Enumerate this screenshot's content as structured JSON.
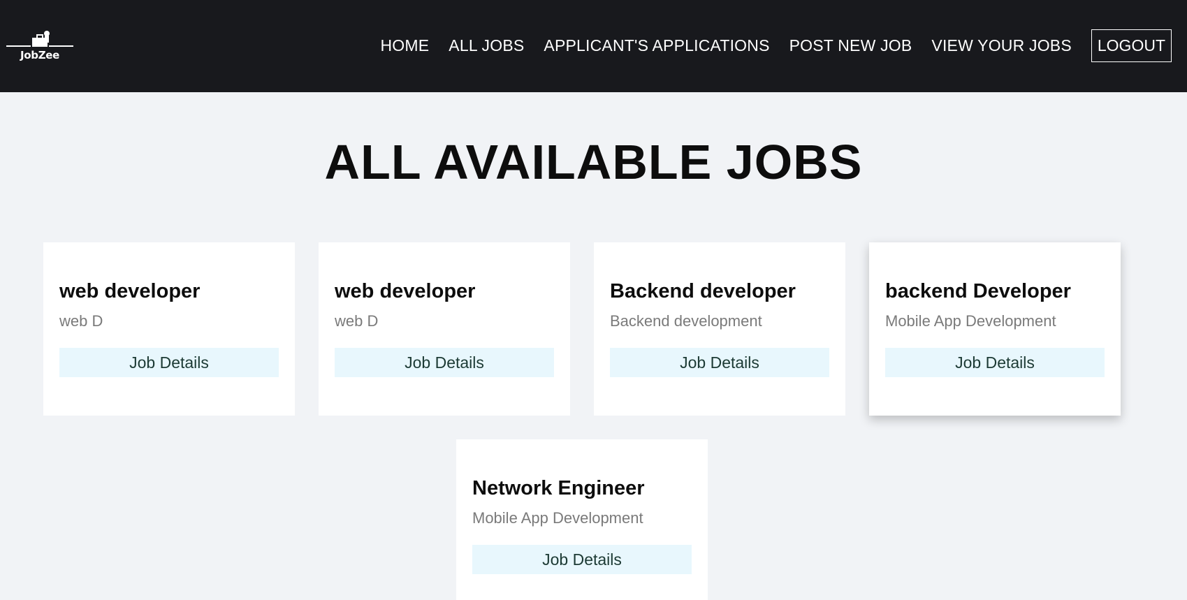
{
  "brand": {
    "name": "JobZee",
    "logo_icon": "job-seeker-logo-icon"
  },
  "nav": {
    "items": [
      {
        "label": "HOME"
      },
      {
        "label": "ALL JOBS"
      },
      {
        "label": "APPLICANT'S APPLICATIONS"
      },
      {
        "label": "POST NEW JOB"
      },
      {
        "label": "VIEW YOUR JOBS"
      }
    ],
    "logout_label": "LOGOUT"
  },
  "page": {
    "title": "ALL AVAILABLE JOBS"
  },
  "jobs": [
    {
      "title": "web developer",
      "category": "web D",
      "button": "Job Details"
    },
    {
      "title": "web developer",
      "category": "web D",
      "button": "Job Details"
    },
    {
      "title": "Backend developer",
      "category": "Backend development",
      "button": "Job Details"
    },
    {
      "title": "backend Developer",
      "category": "Mobile App Development",
      "button": "Job Details"
    },
    {
      "title": "Network Engineer",
      "category": "Mobile App Development",
      "button": "Job Details"
    }
  ],
  "colors": {
    "navbar_bg": "#18191d",
    "page_bg": "#f1f3f6",
    "button_bg": "#e8f7fd",
    "button_text": "#1c3a34"
  }
}
